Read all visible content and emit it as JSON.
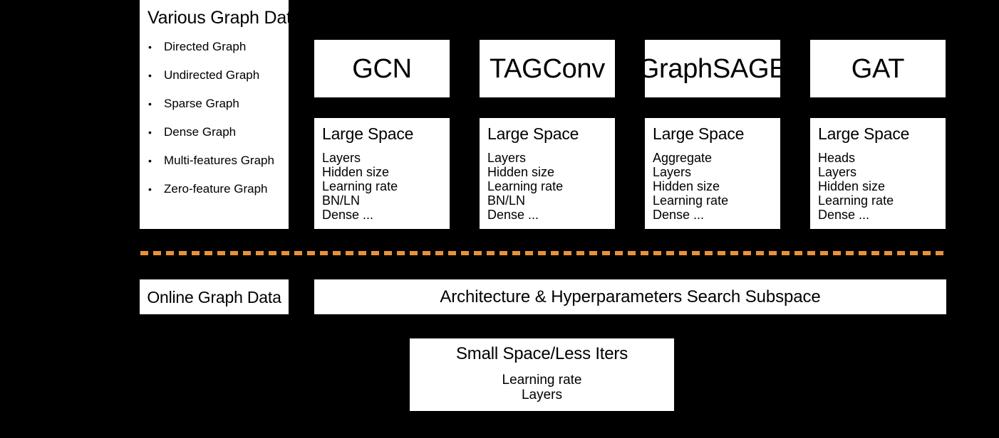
{
  "colors": {
    "background": "#000000",
    "box_fill": "#ffffff",
    "text": "#000000",
    "dashed_separator": "#e8913c"
  },
  "various_graph_data": {
    "title": "Various Graph Data",
    "bullet_glyph": "•",
    "items": [
      "Directed Graph",
      "Undirected Graph",
      "Sparse Graph",
      "Dense Graph",
      "Multi-features Graph",
      "Zero-feature Graph"
    ]
  },
  "models": [
    {
      "name": "GCN",
      "space_title": "Large Space",
      "hyperparameters": [
        "Layers",
        "Hidden size",
        "Learning rate",
        "BN/LN",
        "Dense ..."
      ]
    },
    {
      "name": "TAGConv",
      "space_title": "Large Space",
      "hyperparameters": [
        "Layers",
        "Hidden size",
        "Learning rate",
        "BN/LN",
        "Dense ..."
      ]
    },
    {
      "name": "GraphSAGE",
      "space_title": "Large Space",
      "hyperparameters": [
        "Aggregate",
        "Layers",
        "Hidden size",
        "Learning rate",
        "Dense ..."
      ]
    },
    {
      "name": "GAT",
      "space_title": "Large Space",
      "hyperparameters": [
        "Heads",
        "Layers",
        "Hidden size",
        "Learning rate",
        "Dense ..."
      ]
    }
  ],
  "online_graph_data": {
    "label": "Online Graph Data"
  },
  "search_subspace": {
    "label": "Architecture & Hyperparameters Search Subspace"
  },
  "small_space": {
    "title": "Small Space/Less Iters",
    "hyperparameters": [
      "Learning rate",
      "Layers"
    ]
  }
}
